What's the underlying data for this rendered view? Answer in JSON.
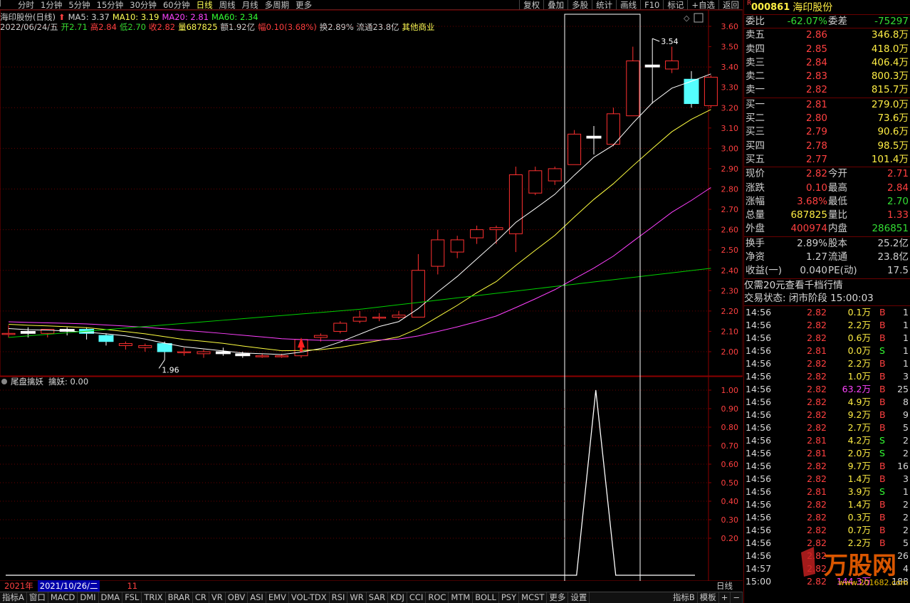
{
  "timeframes": [
    "分时",
    "1分钟",
    "5分钟",
    "15分钟",
    "30分钟",
    "60分钟",
    "日线",
    "周线",
    "月线",
    "多周期",
    "更多"
  ],
  "active_timeframe": "日线",
  "toolbar": [
    "复权",
    "叠加",
    "多股",
    "统计",
    "画线",
    "F10",
    "标记",
    "+自选",
    "返回"
  ],
  "legend": {
    "title": "海印股份(日线)",
    "ma5": "MA5: 3.37",
    "ma10": "MA10: 3.19",
    "ma20": "MA20: 2.81",
    "ma60": "MA60: 2.34",
    "date": "2022/06/24/五",
    "open": "开2.71",
    "high": "高2.84",
    "low": "低2.70",
    "close": "收2.82",
    "vol": "量687825",
    "amount": "额1.92亿",
    "change": "幅0.10(3.68%)",
    "turnover": "换2.89% 流通23.8亿",
    "industry": "其他商业"
  },
  "price_axis": [
    "3.60",
    "3.50",
    "3.40",
    "3.30",
    "3.20",
    "3.10",
    "3.00",
    "2.90",
    "2.80",
    "2.70",
    "2.60",
    "2.50",
    "2.40",
    "2.30",
    "2.20",
    "2.10",
    "2.00"
  ],
  "annotations": {
    "high": "3.54",
    "low": "1.96"
  },
  "indicator": {
    "name": "尾盘擒妖",
    "value": "擒妖: 0.00",
    "axis": [
      "1.00",
      "0.90",
      "0.80",
      "0.70",
      "0.60",
      "0.50",
      "0.40",
      "0.30",
      "0.20"
    ]
  },
  "chart_data": {
    "type": "candlestick",
    "ylim": [
      1.9,
      3.66
    ],
    "candles": [
      {
        "o": 2.09,
        "h": 2.13,
        "l": 2.07,
        "c": 2.09
      },
      {
        "o": 2.1,
        "h": 2.12,
        "l": 2.07,
        "c": 2.09
      },
      {
        "o": 2.09,
        "h": 2.11,
        "l": 2.07,
        "c": 2.11
      },
      {
        "o": 2.11,
        "h": 2.12,
        "l": 2.08,
        "c": 2.1
      },
      {
        "o": 2.11,
        "h": 2.12,
        "l": 2.06,
        "c": 2.09
      },
      {
        "o": 2.08,
        "h": 2.09,
        "l": 2.03,
        "c": 2.05
      },
      {
        "o": 2.03,
        "h": 2.05,
        "l": 2.01,
        "c": 2.04
      },
      {
        "o": 2.02,
        "h": 2.04,
        "l": 2.0,
        "c": 2.03
      },
      {
        "o": 2.04,
        "h": 2.05,
        "l": 1.96,
        "c": 2.0
      },
      {
        "o": 2.0,
        "h": 2.02,
        "l": 1.98,
        "c": 2.0
      },
      {
        "o": 1.99,
        "h": 2.01,
        "l": 1.97,
        "c": 2.0
      },
      {
        "o": 2.0,
        "h": 2.02,
        "l": 1.98,
        "c": 1.99
      },
      {
        "o": 1.99,
        "h": 2.0,
        "l": 1.97,
        "c": 1.98
      },
      {
        "o": 1.98,
        "h": 1.99,
        "l": 1.97,
        "c": 1.98
      },
      {
        "o": 1.98,
        "h": 1.99,
        "l": 1.97,
        "c": 1.98
      },
      {
        "o": 1.98,
        "h": 2.06,
        "l": 1.97,
        "c": 2.06
      },
      {
        "o": 2.07,
        "h": 2.09,
        "l": 2.05,
        "c": 2.08
      },
      {
        "o": 2.1,
        "h": 2.15,
        "l": 2.09,
        "c": 2.14
      },
      {
        "o": 2.15,
        "h": 2.2,
        "l": 2.14,
        "c": 2.17
      },
      {
        "o": 2.17,
        "h": 2.19,
        "l": 2.15,
        "c": 2.17
      },
      {
        "o": 2.17,
        "h": 2.2,
        "l": 2.16,
        "c": 2.18
      },
      {
        "o": 2.17,
        "h": 2.48,
        "l": 2.17,
        "c": 2.4
      },
      {
        "o": 2.42,
        "h": 2.6,
        "l": 2.38,
        "c": 2.55
      },
      {
        "o": 2.49,
        "h": 2.57,
        "l": 2.46,
        "c": 2.55
      },
      {
        "o": 2.56,
        "h": 2.62,
        "l": 2.53,
        "c": 2.6
      },
      {
        "o": 2.6,
        "h": 2.62,
        "l": 2.53,
        "c": 2.61
      },
      {
        "o": 2.58,
        "h": 2.91,
        "l": 2.49,
        "c": 2.87
      },
      {
        "o": 2.78,
        "h": 2.91,
        "l": 2.77,
        "c": 2.89
      },
      {
        "o": 2.84,
        "h": 2.91,
        "l": 2.82,
        "c": 2.9
      },
      {
        "o": 2.92,
        "h": 3.09,
        "l": 2.92,
        "c": 3.07
      },
      {
        "o": 3.06,
        "h": 3.11,
        "l": 2.97,
        "c": 3.05
      },
      {
        "o": 3.02,
        "h": 3.2,
        "l": 3.01,
        "c": 3.17
      },
      {
        "o": 3.16,
        "h": 3.5,
        "l": 3.16,
        "c": 3.43
      },
      {
        "o": 3.41,
        "h": 3.54,
        "l": 3.22,
        "c": 3.4
      },
      {
        "o": 3.39,
        "h": 3.5,
        "l": 3.37,
        "c": 3.43
      },
      {
        "o": 3.34,
        "h": 3.38,
        "l": 3.2,
        "c": 3.22
      },
      {
        "o": 3.21,
        "h": 3.36,
        "l": 3.2,
        "c": 3.35
      }
    ]
  },
  "market": {
    "code": "000861",
    "name": "海印股份",
    "weibi": [
      "委比",
      "-62.07%",
      "委差",
      "-75297"
    ],
    "asks": [
      [
        "卖五",
        "2.86",
        "346.8万"
      ],
      [
        "卖四",
        "2.85",
        "418.0万"
      ],
      [
        "卖三",
        "2.84",
        "406.4万"
      ],
      [
        "卖二",
        "2.83",
        "800.3万"
      ],
      [
        "卖一",
        "2.82",
        "815.7万"
      ]
    ],
    "bids": [
      [
        "买一",
        "2.81",
        "279.0万"
      ],
      [
        "买二",
        "2.80",
        "73.6万"
      ],
      [
        "买三",
        "2.79",
        "90.6万"
      ],
      [
        "买四",
        "2.78",
        "98.5万"
      ],
      [
        "买五",
        "2.77",
        "101.4万"
      ]
    ],
    "stats": [
      [
        "现价",
        "2.82",
        "今开",
        "2.71"
      ],
      [
        "涨跌",
        "0.10",
        "最高",
        "2.84"
      ],
      [
        "涨幅",
        "3.68%",
        "最低",
        "2.70"
      ],
      [
        "总量",
        "687825",
        "量比",
        "1.33"
      ],
      [
        "外盘",
        "400974",
        "内盘",
        "286851"
      ]
    ],
    "stats2": [
      [
        "换手",
        "2.89%",
        "股本",
        "25.2亿"
      ],
      [
        "净资",
        "1.27",
        "流通",
        "23.8亿"
      ],
      [
        "收益(一)",
        "0.040",
        "PE(动)",
        "17.5"
      ]
    ],
    "promo": "仅需20元查看千档行情",
    "status": "交易状态: 闭市阶段 15:00:03"
  },
  "ticks": [
    [
      "14:56",
      "2.82",
      "0.1万",
      "B",
      "1"
    ],
    [
      "14:56",
      "2.82",
      "2.2万",
      "B",
      "1"
    ],
    [
      "14:56",
      "2.82",
      "0.6万",
      "B",
      "1"
    ],
    [
      "14:56",
      "2.81",
      "0.0万",
      "S",
      "1"
    ],
    [
      "14:56",
      "2.82",
      "2.2万",
      "B",
      "1"
    ],
    [
      "14:56",
      "2.82",
      "1.0万",
      "B",
      "3"
    ],
    [
      "14:56",
      "2.82",
      "63.2万",
      "B",
      "25"
    ],
    [
      "14:56",
      "2.82",
      "4.9万",
      "B",
      "8"
    ],
    [
      "14:56",
      "2.82",
      "9.2万",
      "B",
      "9"
    ],
    [
      "14:56",
      "2.82",
      "2.7万",
      "B",
      "5"
    ],
    [
      "14:56",
      "2.81",
      "4.2万",
      "S",
      "2"
    ],
    [
      "14:56",
      "2.81",
      "2.0万",
      "S",
      "2"
    ],
    [
      "14:56",
      "2.82",
      "9.7万",
      "B",
      "16"
    ],
    [
      "14:56",
      "2.82",
      "1.4万",
      "B",
      "3"
    ],
    [
      "14:56",
      "2.81",
      "3.9万",
      "S",
      "1"
    ],
    [
      "14:56",
      "2.82",
      "1.4万",
      "B",
      "2"
    ],
    [
      "14:56",
      "2.82",
      "0.3万",
      "B",
      "2"
    ],
    [
      "14:56",
      "2.82",
      "0.7万",
      "B",
      "2"
    ],
    [
      "14:56",
      "2.82",
      "2.2万",
      "B",
      "5"
    ],
    [
      "14:56",
      "2.82",
      "",
      "",
      "26"
    ],
    [
      "14:57",
      "2.82",
      "",
      "",
      "4"
    ],
    [
      "15:00",
      "2.82",
      "144.3万",
      "",
      "188"
    ]
  ],
  "date_bar": {
    "year": "2021年",
    "date": "2021/10/26/二",
    "month": "11",
    "right_label": "日线"
  },
  "bottom_tabs": [
    "指标A",
    "窗口",
    "MACD",
    "DMI",
    "DMA",
    "FSL",
    "TRIX",
    "BRAR",
    "CR",
    "VR",
    "OBV",
    "ASI",
    "EMV",
    "VOL-TDX",
    "RSI",
    "WR",
    "SAR",
    "KDJ",
    "CCI",
    "ROC",
    "MTM",
    "BOLL",
    "PSY",
    "MCST",
    "更多",
    "设置"
  ],
  "bottom_right": [
    "指标B",
    "模板",
    "+",
    "−"
  ],
  "watermark": "万股网",
  "watermark_url": "www.201682.com",
  "colors": {
    "up": "#ff3030",
    "down": "#54ffff",
    "ma5": "#ffffff",
    "ma10": "#ffff40",
    "ma20": "#ff40ff",
    "ma60": "#00d000"
  }
}
